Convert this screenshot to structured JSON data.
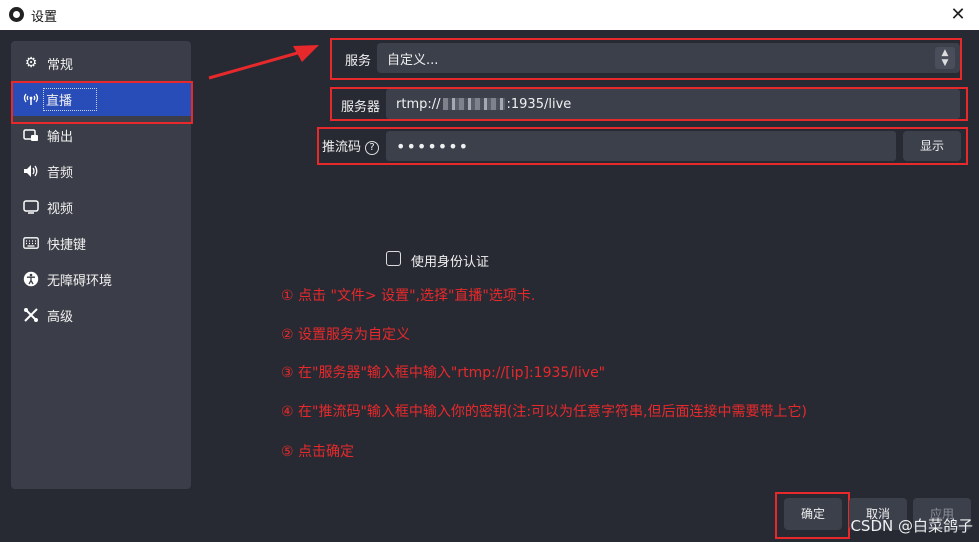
{
  "window": {
    "title": "设置",
    "close_label": "✕"
  },
  "sidebar": {
    "items": [
      {
        "label": "常规",
        "icon": "gear-icon",
        "glyph": "⚙"
      },
      {
        "label": "直播",
        "icon": "antenna-icon",
        "glyph": "📡"
      },
      {
        "label": "输出",
        "icon": "output-icon",
        "glyph": "⎆"
      },
      {
        "label": "音频",
        "icon": "speaker-icon",
        "glyph": "🔊"
      },
      {
        "label": "视频",
        "icon": "monitor-icon",
        "glyph": "🖵"
      },
      {
        "label": "快捷键",
        "icon": "keyboard-icon",
        "glyph": "⌨"
      },
      {
        "label": "无障碍环境",
        "icon": "accessibility-icon",
        "glyph": "♿"
      },
      {
        "label": "高级",
        "icon": "tools-icon",
        "glyph": "✂"
      }
    ],
    "active_index": 1
  },
  "stream": {
    "service_label": "服务",
    "service_value": "自定义...",
    "server_label": "服务器",
    "server_prefix": "rtmp://",
    "server_suffix": ":1935/live",
    "key_label": "推流码",
    "key_value": "•••••••",
    "show_button": "显示",
    "auth_label": "使用身份认证"
  },
  "instructions": [
    "① 点击 \"文件> 设置\",选择\"直播\"选项卡.",
    "② 设置服务为自定义",
    "③ 在\"服务器\"输入框中输入\"rtmp://[ip]:1935/live\"",
    "④ 在\"推流码\"输入框中输入你的密钥(注:可以为任意字符串,但后面连接中需要带上它)",
    "⑤ 点击确定"
  ],
  "footer": {
    "ok": "确定",
    "cancel": "取消",
    "apply": "应用"
  },
  "watermark": "CSDN @白菜鸽子",
  "colors": {
    "accent_red": "#e8292b",
    "active_blue": "#284cb8"
  }
}
